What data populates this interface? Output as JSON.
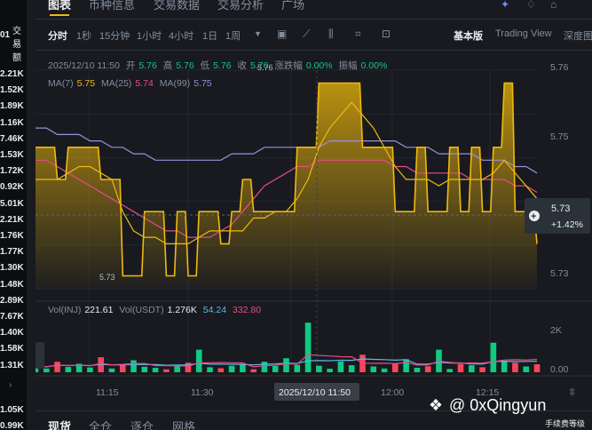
{
  "left": {
    "header": "交易额",
    "prefix": "01",
    "values": [
      "2.21K",
      "1.52K",
      "1.89K",
      "1.16K",
      "7.46K",
      "1.53K",
      "1.72K",
      "0.92K",
      "5.01K",
      "2.21K",
      "1.76K",
      "1.77K",
      "1.30K",
      "1.48K",
      "2.89K",
      "7.67K",
      "1.40K",
      "1.58K",
      "1.31K"
    ],
    "lower_values": [
      "1.05K",
      "0.99K"
    ]
  },
  "top_tabs": [
    "图表",
    "币种信息",
    "交易数据",
    "交易分析",
    "广场"
  ],
  "toolbar": {
    "intervals": [
      "分时",
      "1秒",
      "15分钟",
      "1小时",
      "4小时",
      "1日",
      "1周"
    ],
    "views": [
      "基本版",
      "Trading View",
      "深度图"
    ]
  },
  "legend": {
    "date": "2025/12/10 11:50",
    "open_label": "开",
    "open": "5.76",
    "high_label": "高",
    "high": "5.76",
    "low_label": "低",
    "low": "5.76",
    "close_label": "收",
    "close": "5.76",
    "change_label": "涨跌幅",
    "change": "0.00%",
    "amp_label": "振幅",
    "amp": "0.00%",
    "ma7_label": "MA(7)",
    "ma7": "5.75",
    "ma25_label": "MA(25)",
    "ma25": "5.74",
    "ma99_label": "MA(99)",
    "ma99": "5.75"
  },
  "price_axis": [
    "5.76",
    "5.75",
    "5.73",
    "5.73"
  ],
  "price_tag": {
    "price": "5.73",
    "change": "+1.42%"
  },
  "high_mark": "5.76",
  "low_mark": "5.73",
  "vol_legend": {
    "inj_label": "Vol(INJ)",
    "inj": "221.61",
    "usdt_label": "Vol(USDT)",
    "usdt": "1.276K",
    "ma1": "54.24",
    "ma2": "332.80"
  },
  "vol_axis": [
    "2K",
    "0.00"
  ],
  "time_axis": [
    "11:15",
    "11:30",
    "12:00",
    "12:15"
  ],
  "crosshair_time": "2025/12/10 11:50",
  "bottom_tabs": [
    "现货",
    "全仓",
    "逐仓",
    "网格"
  ],
  "watermark": "@ 0xQingyun",
  "watermark2": "手续费等级",
  "colors": {
    "background": "#181a20",
    "line": "#f0b90b",
    "ma7": "#f0b90b",
    "ma25": "#e84b8a",
    "ma99": "#9b8fd9",
    "up": "#0ecb81",
    "down": "#f6465d"
  },
  "chart_data": {
    "type": "line",
    "price_series": [
      5.75,
      5.75,
      5.745,
      5.75,
      5.75,
      5.75,
      5.745,
      5.745,
      5.73,
      5.73,
      5.74,
      5.74,
      5.73,
      5.74,
      5.73,
      5.74,
      5.74,
      5.735,
      5.74,
      5.745,
      5.74,
      5.74,
      5.74,
      5.74,
      5.75,
      5.75,
      5.76,
      5.76,
      5.76,
      5.76,
      5.75,
      5.75,
      5.75,
      5.74,
      5.74,
      5.75,
      5.74,
      5.74,
      5.75,
      5.74,
      5.75,
      5.74,
      5.75,
      5.76,
      5.74,
      5.74,
      5.735
    ],
    "ma7": [
      5.745,
      5.745,
      5.745,
      5.746,
      5.747,
      5.747,
      5.746,
      5.745,
      5.74,
      5.737,
      5.736,
      5.736,
      5.735,
      5.735,
      5.735,
      5.736,
      5.737,
      5.737,
      5.737,
      5.737,
      5.739,
      5.739,
      5.74,
      5.74,
      5.742,
      5.745,
      5.75,
      5.753,
      5.755,
      5.757,
      5.755,
      5.753,
      5.75,
      5.747,
      5.745,
      5.745,
      5.745,
      5.744,
      5.745,
      5.745,
      5.745,
      5.745,
      5.746,
      5.748,
      5.746,
      5.744,
      5.742
    ],
    "ma25": [
      5.748,
      5.748,
      5.747,
      5.746,
      5.745,
      5.744,
      5.743,
      5.742,
      5.741,
      5.74,
      5.739,
      5.738,
      5.737,
      5.737,
      5.736,
      5.736,
      5.736,
      5.737,
      5.738,
      5.74,
      5.742,
      5.744,
      5.745,
      5.746,
      5.747,
      5.747,
      5.748,
      5.748,
      5.748,
      5.748,
      5.748,
      5.748,
      5.748,
      5.747,
      5.747,
      5.746,
      5.746,
      5.746,
      5.746,
      5.746,
      5.745,
      5.745,
      5.745,
      5.745,
      5.744,
      5.744,
      5.743
    ],
    "ma99": [
      5.753,
      5.753,
      5.752,
      5.752,
      5.752,
      5.751,
      5.751,
      5.75,
      5.75,
      5.749,
      5.749,
      5.748,
      5.748,
      5.748,
      5.748,
      5.748,
      5.748,
      5.748,
      5.749,
      5.749,
      5.749,
      5.75,
      5.75,
      5.75,
      5.75,
      5.75,
      5.75,
      5.751,
      5.751,
      5.751,
      5.751,
      5.751,
      5.751,
      5.751,
      5.75,
      5.75,
      5.75,
      5.749,
      5.749,
      5.749,
      5.749,
      5.748,
      5.748,
      5.748,
      5.747,
      5.747,
      5.746
    ],
    "volumes": [
      280,
      150,
      420,
      210,
      340,
      190,
      600,
      150,
      300,
      480,
      220,
      180,
      120,
      300,
      380,
      900,
      200,
      160,
      260,
      340,
      120,
      420,
      250,
      560,
      300,
      1980,
      260,
      140,
      430,
      280,
      700,
      230,
      150,
      360,
      520,
      180,
      240,
      900,
      130,
      320,
      280,
      200,
      1180,
      460,
      380,
      230,
      320
    ],
    "ylim": [
      5.728,
      5.762
    ],
    "vol_ylim": [
      0,
      2200
    ]
  }
}
